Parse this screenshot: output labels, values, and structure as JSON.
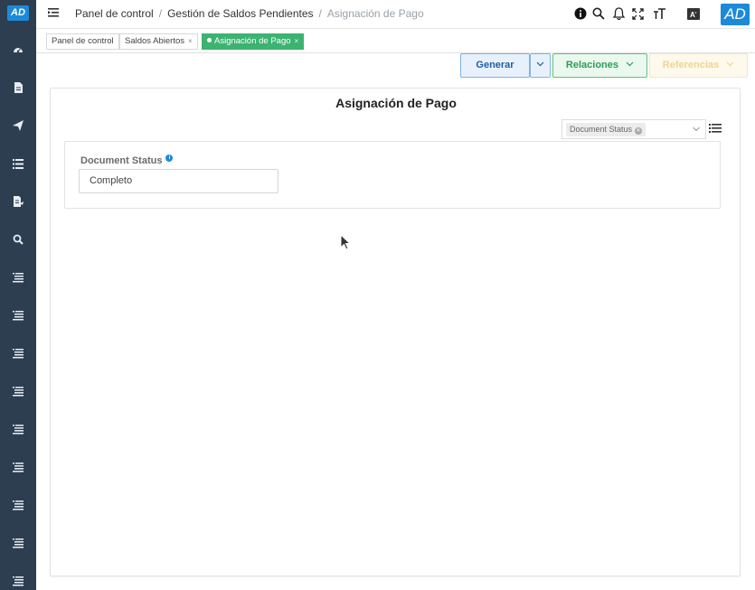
{
  "app": {
    "logo": "AD",
    "avatar": "AD"
  },
  "breadcrumb": {
    "items": [
      "Panel de control",
      "Gestión de Saldos Pendientes"
    ],
    "separator": "/",
    "current": "Asignación de Pago"
  },
  "tabs": [
    {
      "label": "Panel de control",
      "closable": false,
      "active": false
    },
    {
      "label": "Saldos Abiertos",
      "close": "×",
      "active": false
    },
    {
      "label": "Asignación de Pago",
      "close": "×",
      "active": true
    }
  ],
  "actions": {
    "generar": "Generar",
    "relaciones": "Relaciones",
    "referencias": "Referencias"
  },
  "form": {
    "title": "Asignación de Pago",
    "filter_chip": "Document Status",
    "field_label": "Document Status",
    "field_value": "Completo",
    "info_glyph": "i"
  },
  "colors": {
    "sidebar": "#2d3e50",
    "brand": "#1c8ad9",
    "active_tab": "#3cb371",
    "relaciones": "#2d9c52",
    "generar": "#1f5f9e"
  }
}
